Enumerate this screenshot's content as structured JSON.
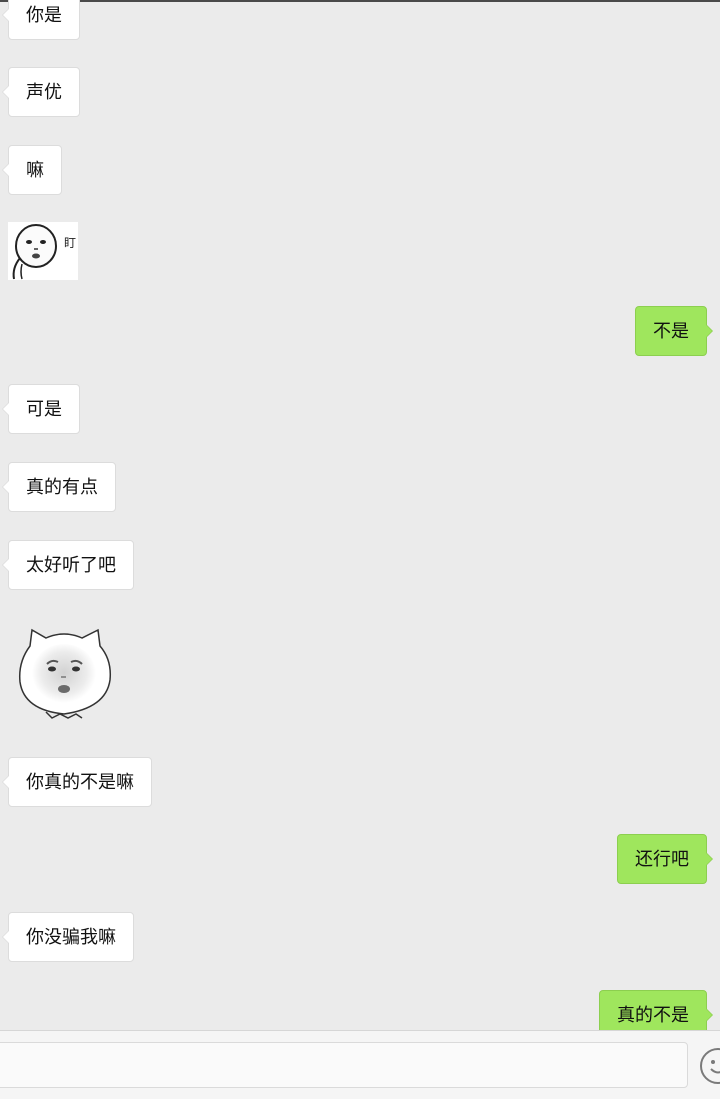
{
  "messages": [
    {
      "side": "left",
      "text": "你是"
    },
    {
      "side": "left",
      "text": "声优"
    },
    {
      "side": "left",
      "text": "嘛"
    },
    {
      "side": "left",
      "sticker": "stare-face-sticker",
      "caption": "盯"
    },
    {
      "side": "right",
      "text": "不是"
    },
    {
      "side": "left",
      "text": "可是"
    },
    {
      "side": "left",
      "text": "真的有点"
    },
    {
      "side": "left",
      "text": "太好听了吧"
    },
    {
      "side": "left",
      "sticker": "cat-baby-face-sticker"
    },
    {
      "side": "left",
      "text": "你真的不是嘛"
    },
    {
      "side": "right",
      "text": "还行吧"
    },
    {
      "side": "left",
      "text": "你没骗我嘛"
    },
    {
      "side": "right",
      "text": "真的不是"
    }
  ],
  "input": {
    "value": "",
    "placeholder": ""
  },
  "icons": {
    "emoji": "smiley-face-icon"
  },
  "colors": {
    "background": "#ebebeb",
    "incoming_bubble": "#ffffff",
    "outgoing_bubble": "#9fe65d"
  }
}
